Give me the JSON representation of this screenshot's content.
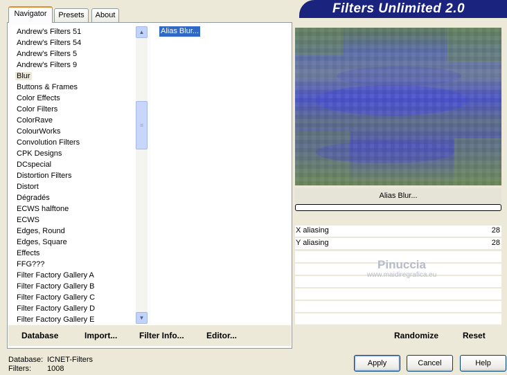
{
  "banner": {
    "title": "Filters Unlimited 2.0"
  },
  "tabs": [
    {
      "label": "Navigator",
      "active": true
    },
    {
      "label": "Presets",
      "active": false
    },
    {
      "label": "About",
      "active": false
    }
  ],
  "categories": [
    "Andrew's Filters 51",
    "Andrew's Filters 54",
    "Andrew's Filters 5",
    "Andrew's Filters 9",
    "Blur",
    "Buttons & Frames",
    "Color Effects",
    "Color Filters",
    "ColorRave",
    "ColourWorks",
    "Convolution Filters",
    "CPK Designs",
    "DCspecial",
    "Distortion Filters",
    "Distort",
    "Dégradés",
    "ECWS halftone",
    "ECWS",
    "Edges, Round",
    "Edges, Square",
    "Effects",
    "FFG???",
    "Filter Factory Gallery A",
    "Filter Factory Gallery B",
    "Filter Factory Gallery C",
    "Filter Factory Gallery D",
    "Filter Factory Gallery E"
  ],
  "selected_category_index": 4,
  "filters": {
    "selected": "Alias Blur..."
  },
  "toolbar": {
    "database": "Database",
    "import": "Import...",
    "filter_info": "Filter Info...",
    "editor": "Editor..."
  },
  "preview": {
    "label": "Alias Blur..."
  },
  "params": [
    {
      "name": "X aliasing",
      "value": "28"
    },
    {
      "name": "Y aliasing",
      "value": "28"
    }
  ],
  "watermark": {
    "line1": "Pinuccia",
    "line2": "www.maidiregrafica.eu"
  },
  "right_toolbar": {
    "randomize": "Randomize",
    "reset": "Reset"
  },
  "status": {
    "database_label": "Database:",
    "database_value": "ICNET-Filters",
    "filters_label": "Filters:",
    "filters_value": "1008"
  },
  "buttons": {
    "apply": "Apply",
    "cancel": "Cancel",
    "help": "Help"
  },
  "colors": {
    "banner": "#1a237e",
    "selection": "#316ac5",
    "tab_accent": "#e68b2c"
  }
}
